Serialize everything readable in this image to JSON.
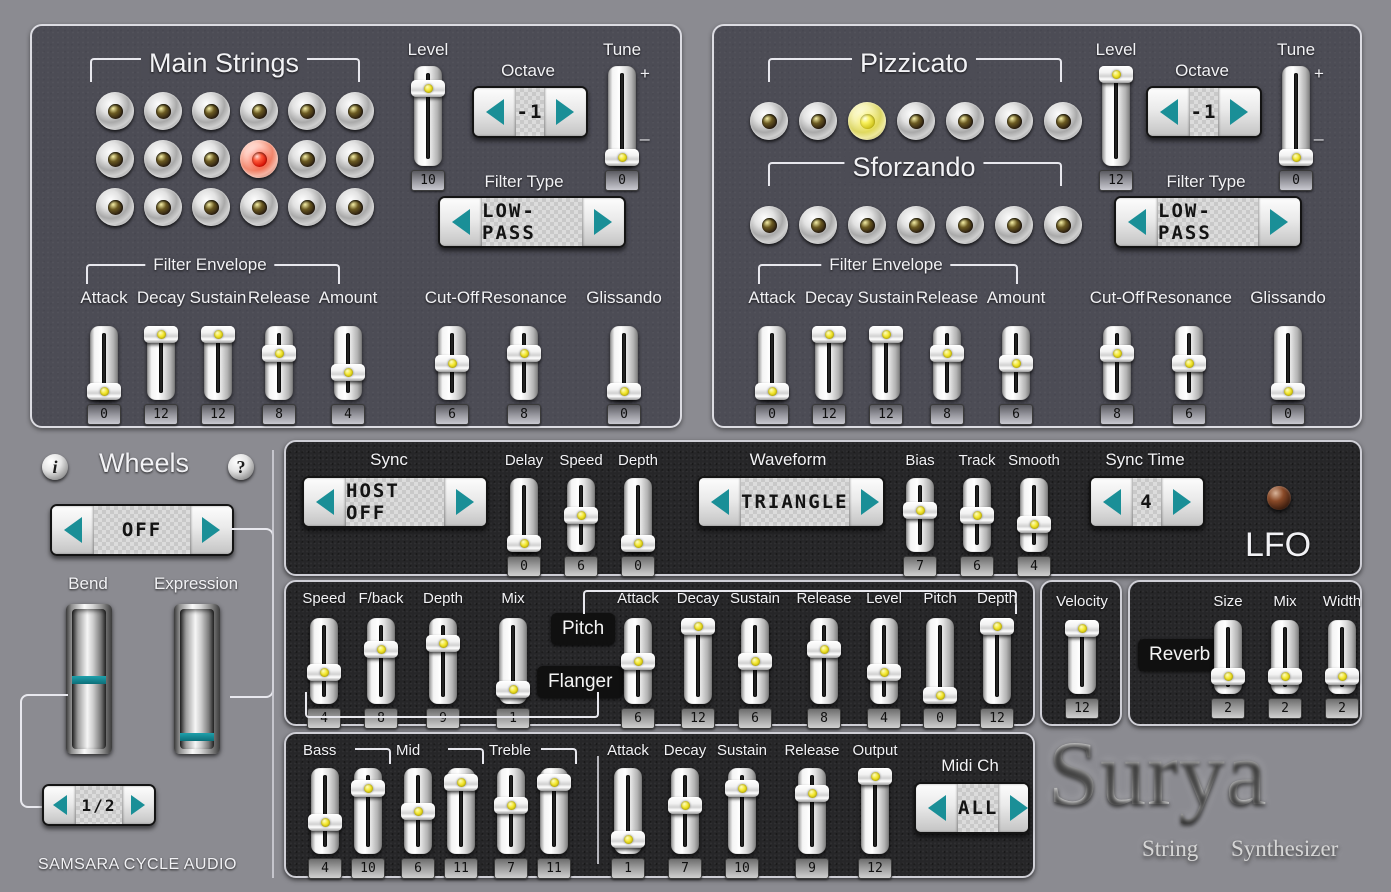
{
  "brand": {
    "name": "Surya",
    "sub_left": "String",
    "sub_right": "Synthesizer",
    "company": "SAMSARA CYCLE AUDIO",
    "accent": "#1a8f97",
    "led_on": "#f5e82e",
    "panel_bg": "#4c4c55",
    "dark_bg": "#262628"
  },
  "main_strings": {
    "title": "Main Strings",
    "buttons": [
      {
        "state": "off"
      },
      {
        "state": "off"
      },
      {
        "state": "off"
      },
      {
        "state": "off"
      },
      {
        "state": "off"
      },
      {
        "state": "off"
      },
      {
        "state": "off"
      },
      {
        "state": "off"
      },
      {
        "state": "off"
      },
      {
        "state": "on-red"
      },
      {
        "state": "off"
      },
      {
        "state": "off"
      },
      {
        "state": "off"
      },
      {
        "state": "off"
      },
      {
        "state": "off"
      },
      {
        "state": "off"
      },
      {
        "state": "off"
      },
      {
        "state": "off"
      }
    ],
    "level": {
      "label": "Level",
      "value": "10",
      "max": 12
    },
    "octave": {
      "label": "Octave",
      "value": "-1"
    },
    "tune": {
      "label": "Tune",
      "value": "0",
      "plus": "+",
      "minus": "_",
      "max": 12
    },
    "filter_type": {
      "label": "Filter Type",
      "value": "LOW-PASS"
    },
    "filter_envelope": {
      "title": "Filter Envelope",
      "sliders": [
        {
          "label": "Attack",
          "value": "0",
          "max": 12
        },
        {
          "label": "Decay",
          "value": "12",
          "max": 12
        },
        {
          "label": "Sustain",
          "value": "12",
          "max": 12
        },
        {
          "label": "Release",
          "value": "8",
          "max": 12
        },
        {
          "label": "Amount",
          "value": "4",
          "max": 12
        }
      ]
    },
    "extra": [
      {
        "label": "Cut-Off",
        "value": "6",
        "max": 12
      },
      {
        "label": "Resonance",
        "value": "8",
        "max": 12
      },
      {
        "label": "Glissando",
        "value": "0",
        "max": 12
      }
    ]
  },
  "pizzicato": {
    "title": "Pizzicato",
    "buttons": [
      {
        "state": "off"
      },
      {
        "state": "off"
      },
      {
        "state": "on-yellow"
      },
      {
        "state": "off"
      },
      {
        "state": "off"
      },
      {
        "state": "off"
      },
      {
        "state": "off"
      }
    ],
    "sforzando_title": "Sforzando",
    "sforzando_buttons": [
      {
        "state": "off"
      },
      {
        "state": "off"
      },
      {
        "state": "off"
      },
      {
        "state": "off"
      },
      {
        "state": "off"
      },
      {
        "state": "off"
      },
      {
        "state": "off"
      }
    ],
    "level": {
      "label": "Level",
      "value": "12",
      "max": 12
    },
    "octave": {
      "label": "Octave",
      "value": "-1"
    },
    "tune": {
      "label": "Tune",
      "value": "0",
      "plus": "+",
      "minus": "_",
      "max": 12
    },
    "filter_type": {
      "label": "Filter Type",
      "value": "LOW-PASS"
    },
    "filter_envelope": {
      "title": "Filter Envelope",
      "sliders": [
        {
          "label": "Attack",
          "value": "0",
          "max": 12
        },
        {
          "label": "Decay",
          "value": "12",
          "max": 12
        },
        {
          "label": "Sustain",
          "value": "12",
          "max": 12
        },
        {
          "label": "Release",
          "value": "8",
          "max": 12
        },
        {
          "label": "Amount",
          "value": "6",
          "max": 12
        }
      ]
    },
    "extra": [
      {
        "label": "Cut-Off",
        "value": "8",
        "max": 12
      },
      {
        "label": "Resonance",
        "value": "6",
        "max": 12
      },
      {
        "label": "Glissando",
        "value": "0",
        "max": 12
      }
    ]
  },
  "wheels": {
    "title": "Wheels",
    "info_icon": "i",
    "help_icon": "?",
    "mode": {
      "value": "OFF"
    },
    "bend": {
      "label": "Bend",
      "position": 0.5
    },
    "expression": {
      "label": "Expression",
      "position": 0.06
    },
    "range": {
      "value": "1/2"
    }
  },
  "lfo": {
    "title": "LFO",
    "sync": {
      "label": "Sync",
      "value": "HOST OFF"
    },
    "sliders": [
      {
        "label": "Delay",
        "value": "0",
        "max": 12
      },
      {
        "label": "Speed",
        "value": "6",
        "max": 12
      },
      {
        "label": "Depth",
        "value": "0",
        "max": 12
      }
    ],
    "waveform": {
      "label": "Waveform",
      "value": "TRIANGLE"
    },
    "sliders2": [
      {
        "label": "Bias",
        "value": "7",
        "max": 12
      },
      {
        "label": "Track",
        "value": "6",
        "max": 12
      },
      {
        "label": "Smooth",
        "value": "4",
        "max": 12
      }
    ],
    "sync_time": {
      "label": "Sync Time",
      "value": "4"
    }
  },
  "flanger": {
    "tag": "Flanger",
    "sliders": [
      {
        "label": "Speed",
        "value": "4",
        "max": 12
      },
      {
        "label": "F/back",
        "value": "8",
        "max": 12
      },
      {
        "label": "Depth",
        "value": "9",
        "max": 12
      },
      {
        "label": "Mix",
        "value": "1",
        "max": 12
      }
    ]
  },
  "pitch": {
    "tag": "Pitch",
    "sliders": [
      {
        "label": "Attack",
        "value": "6",
        "max": 12
      },
      {
        "label": "Decay",
        "value": "12",
        "max": 12
      },
      {
        "label": "Sustain",
        "value": "6",
        "max": 12
      },
      {
        "label": "Release",
        "value": "8",
        "max": 12
      },
      {
        "label": "Level",
        "value": "4",
        "max": 12
      },
      {
        "label": "Pitch",
        "value": "0",
        "max": 12
      },
      {
        "label": "Depth",
        "value": "12",
        "max": 12
      }
    ]
  },
  "velocity": {
    "label": "Velocity",
    "value": "12",
    "max": 12
  },
  "reverb": {
    "tag": "Reverb",
    "sliders": [
      {
        "label": "Size",
        "value": "2",
        "max": 12
      },
      {
        "label": "Mix",
        "value": "2",
        "max": 12
      },
      {
        "label": "Width",
        "value": "2",
        "max": 12
      }
    ]
  },
  "eq": {
    "groups": [
      {
        "label": "Bass",
        "sliders": [
          {
            "value": "4",
            "max": 12
          },
          {
            "value": "10",
            "max": 12
          }
        ]
      },
      {
        "label": "Mid",
        "sliders": [
          {
            "value": "6",
            "max": 12
          },
          {
            "value": "11",
            "max": 12
          }
        ]
      },
      {
        "label": "Treble",
        "sliders": [
          {
            "value": "7",
            "max": 12
          },
          {
            "value": "11",
            "max": 12
          }
        ]
      }
    ]
  },
  "amp": {
    "sliders": [
      {
        "label": "Attack",
        "value": "1",
        "max": 12
      },
      {
        "label": "Decay",
        "value": "7",
        "max": 12
      },
      {
        "label": "Sustain",
        "value": "10",
        "max": 12
      },
      {
        "label": "Release",
        "value": "9",
        "max": 12
      },
      {
        "label": "Output",
        "value": "12",
        "max": 12
      }
    ],
    "midi_ch": {
      "label": "Midi Ch",
      "value": "ALL"
    }
  }
}
